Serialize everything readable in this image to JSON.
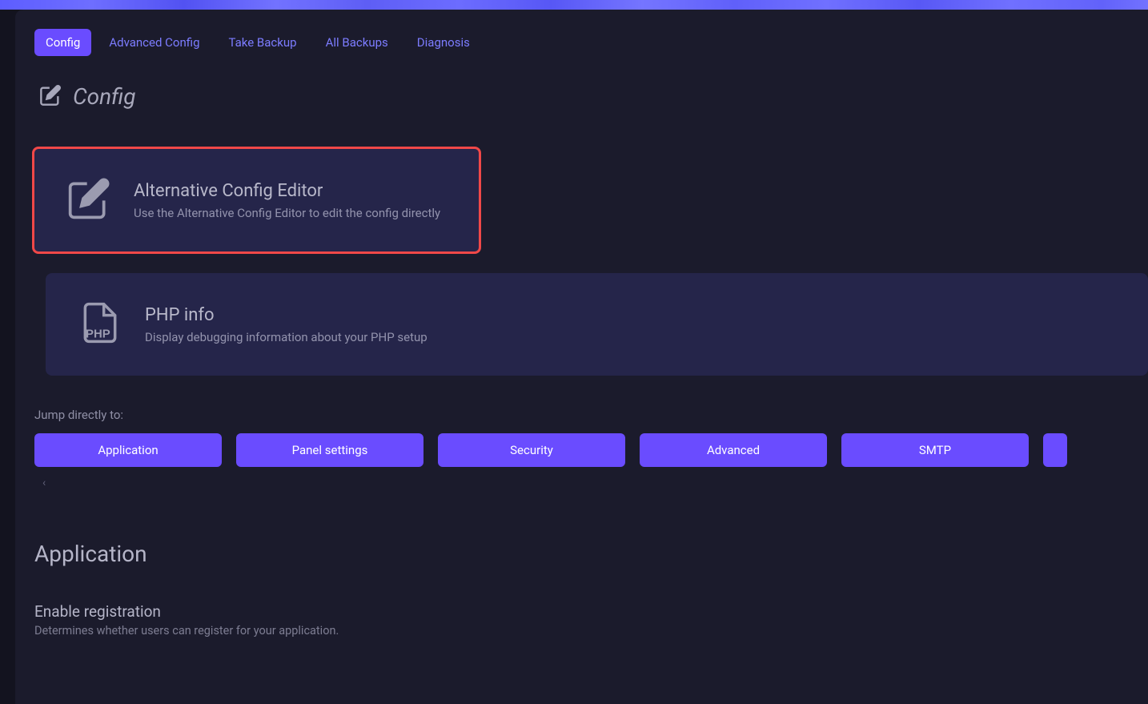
{
  "tabs": [
    {
      "label": "Config",
      "active": true
    },
    {
      "label": "Advanced Config",
      "active": false
    },
    {
      "label": "Take Backup",
      "active": false
    },
    {
      "label": "All Backups",
      "active": false
    },
    {
      "label": "Diagnosis",
      "active": false
    }
  ],
  "page_title": "Config",
  "cards": {
    "alt_editor": {
      "title": "Alternative Config Editor",
      "desc": "Use the Alternative Config Editor to edit the config directly"
    },
    "php_info": {
      "title": "PHP info",
      "desc": "Display debugging information about your PHP setup"
    }
  },
  "jump": {
    "label": "Jump directly to:",
    "items": [
      "Application",
      "Panel settings",
      "Security",
      "Advanced",
      "SMTP"
    ]
  },
  "section": {
    "heading": "Application",
    "setting_title": "Enable registration",
    "setting_desc": "Determines whether users can register for your application."
  }
}
